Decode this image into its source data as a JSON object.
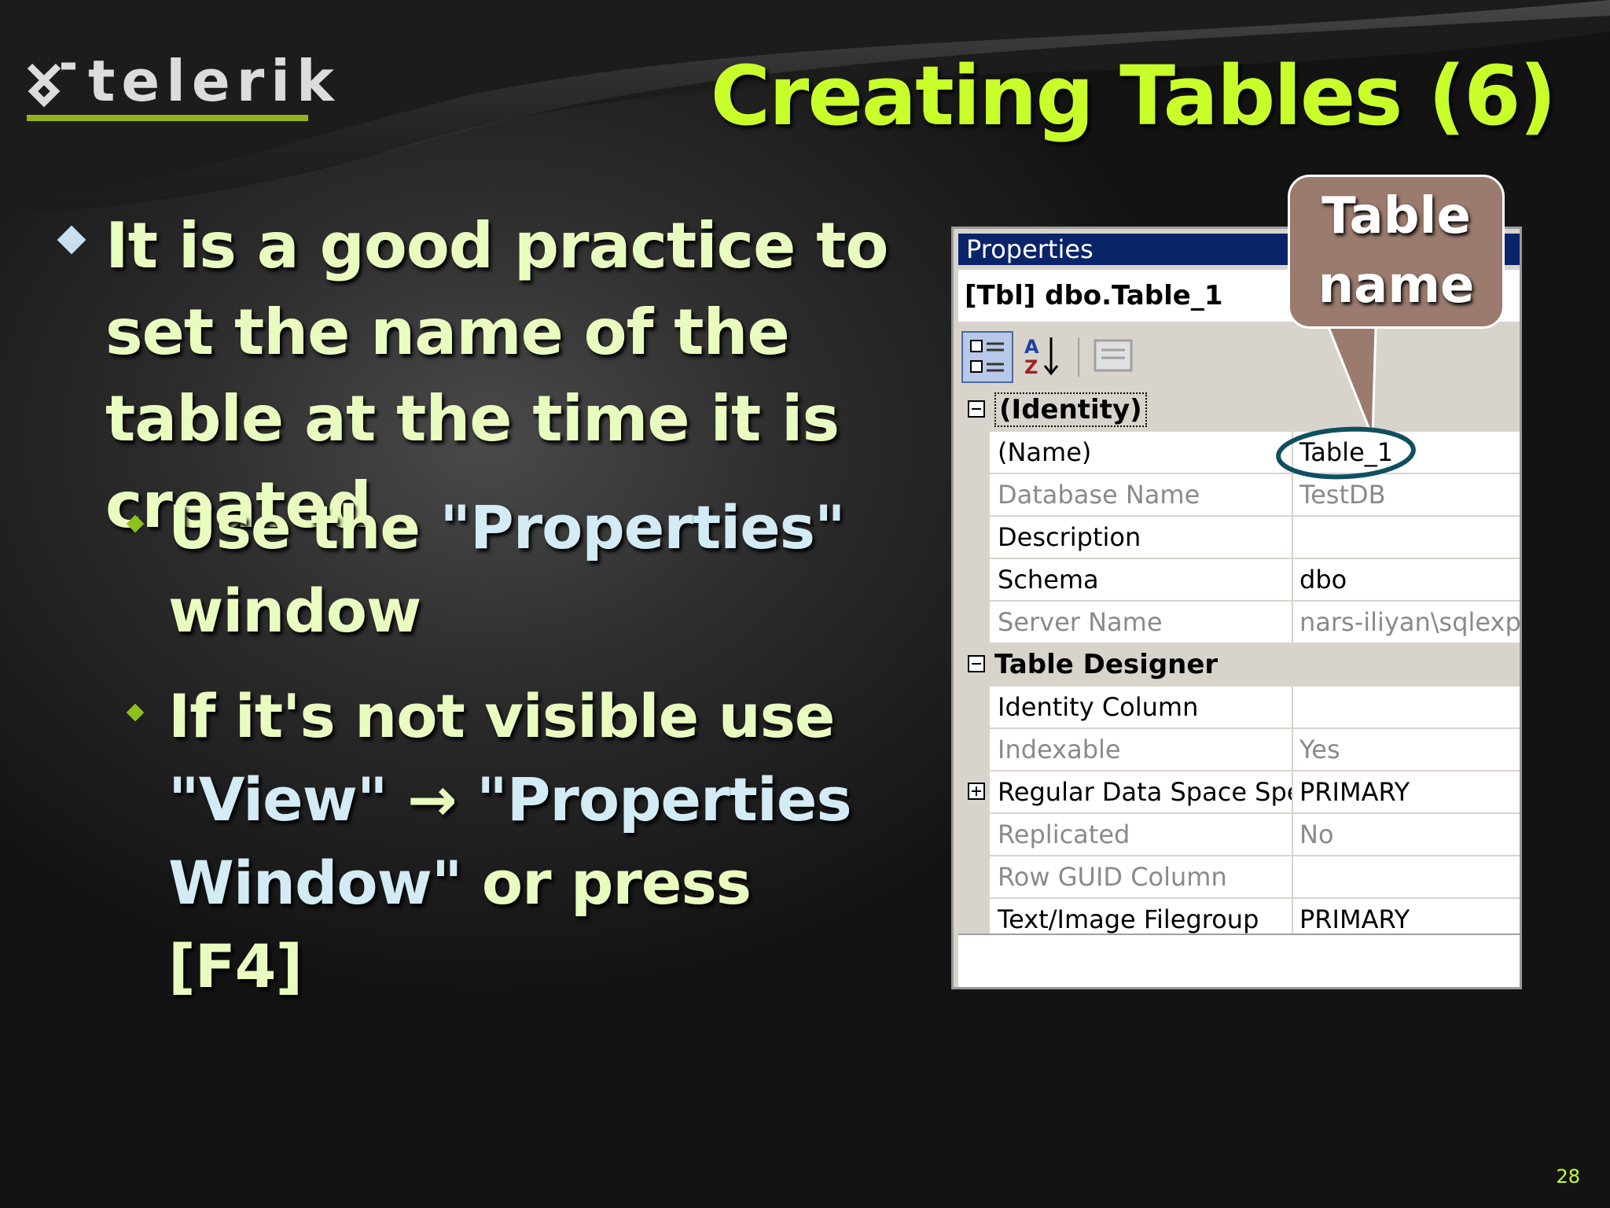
{
  "logo": {
    "text": "telerik"
  },
  "title": "Creating Tables (6)",
  "bullets": {
    "main": "It is a good practice to set the name of the table at the time it is created",
    "sub1": {
      "prefix": "Use the ",
      "quoted": "\"Properties\"",
      "suffix": " window"
    },
    "sub2": {
      "prefix": "If it's not visible use ",
      "quoted1": "\"View\"",
      "arrow": " → ",
      "quoted2": "\"Properties Window\"",
      "suffix": " or press [F4]"
    }
  },
  "callout": {
    "line1": "Table",
    "line2": "name"
  },
  "properties": {
    "title": "Properties",
    "object": "[Tbl] dbo.Table_1",
    "toolbar": [
      "categorized-icon",
      "alphabetical-icon",
      "property-pages-icon"
    ],
    "categories": [
      {
        "name": "(Identity)",
        "expanded": true,
        "rows": [
          {
            "name": "(Name)",
            "value": "Table_1",
            "readonly": false
          },
          {
            "name": "Database Name",
            "value": "TestDB",
            "readonly": true
          },
          {
            "name": "Description",
            "value": "",
            "readonly": false
          },
          {
            "name": "Schema",
            "value": "dbo",
            "readonly": false
          },
          {
            "name": "Server Name",
            "value": "nars-iliyan\\sqlexpr",
            "readonly": true
          }
        ]
      },
      {
        "name": "Table Designer",
        "expanded": true,
        "rows": [
          {
            "name": "Identity Column",
            "value": "",
            "readonly": false
          },
          {
            "name": "Indexable",
            "value": "Yes",
            "readonly": true
          },
          {
            "name": "Regular Data Space Spec",
            "value": "PRIMARY",
            "readonly": false,
            "expandable": true
          },
          {
            "name": "Replicated",
            "value": "No",
            "readonly": true
          },
          {
            "name": "Row GUID Column",
            "value": "",
            "readonly": true
          },
          {
            "name": "Text/Image Filegroup",
            "value": "PRIMARY",
            "readonly": false
          }
        ]
      }
    ]
  },
  "page_number": "28",
  "colors": {
    "title": "#c8ff2a",
    "text": "#e9fcc0",
    "quote": "#d3ebf5",
    "accent": "#8fb51e",
    "callout": "#9a7b6e"
  }
}
